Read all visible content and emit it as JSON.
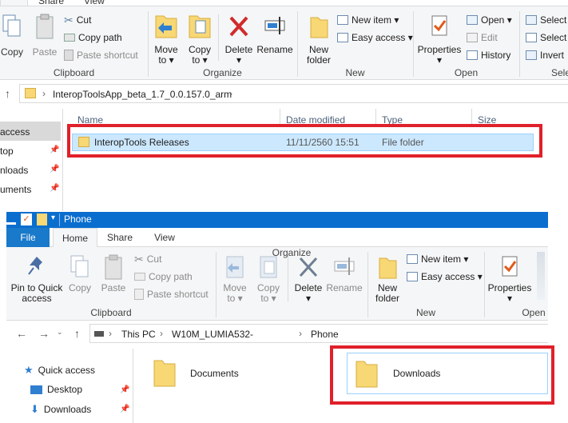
{
  "top_window": {
    "tabs": [
      "",
      "Share",
      "View"
    ],
    "clipboard": {
      "copy": "Copy",
      "paste": "Paste",
      "cut": "Cut",
      "copy_path": "Copy path",
      "paste_shortcut": "Paste shortcut",
      "label": "Clipboard"
    },
    "organize": {
      "move_to": "Move",
      "move_to_2": "to ▾",
      "copy_to": "Copy",
      "copy_to_2": "to ▾",
      "delete": "Delete",
      "delete_2": "▾",
      "rename": "Rename",
      "label": "Organize"
    },
    "new": {
      "new_folder": "New",
      "new_folder_2": "folder",
      "new_item": "New item ▾",
      "easy_access": "Easy access ▾",
      "label": "New"
    },
    "open": {
      "properties": "Properties",
      "properties_2": "▾",
      "open": "Open ▾",
      "edit": "Edit",
      "history": "History",
      "label": "Open"
    },
    "select": {
      "select_all": "Select",
      "select_none": "Select",
      "invert": "Invert",
      "label": "Sele"
    },
    "address": {
      "path": "InteropToolsApp_beta_1.7_0.0.157.0_arm"
    },
    "columns": {
      "name": "Name",
      "date": "Date modified",
      "type": "Type",
      "size": "Size"
    },
    "row": {
      "name": "InteropTools Releases",
      "date": "11/11/2560 15:51",
      "type": "File folder"
    },
    "nav": [
      "access",
      "top",
      "nloads",
      "uments"
    ]
  },
  "bottom_window": {
    "title": "Phone",
    "tabs": {
      "file": "File",
      "home": "Home",
      "share": "Share",
      "view": "View"
    },
    "clipboard": {
      "pin": "Pin to Quick",
      "pin_2": "access",
      "copy": "Copy",
      "paste": "Paste",
      "cut": "Cut",
      "copy_path": "Copy path",
      "paste_shortcut": "Paste shortcut",
      "label": "Clipboard"
    },
    "organize": {
      "move_to": "Move",
      "move_to_2": "to ▾",
      "copy_to": "Copy",
      "copy_to_2": "to ▾",
      "delete": "Delete",
      "delete_2": "▾",
      "rename": "Rename",
      "label": "Organize"
    },
    "new": {
      "new_folder": "New",
      "new_folder_2": "folder",
      "new_item": "New item ▾",
      "easy_access": "Easy access ▾",
      "label": "New"
    },
    "open": {
      "properties": "Properties",
      "properties_2": "▾",
      "label": "Open"
    },
    "address": {
      "this_pc": "This PC",
      "device": "W10M_LUMIA532-",
      "phone": "Phone"
    },
    "nav": {
      "quick_access": "Quick access",
      "desktop": "Desktop",
      "downloads": "Downloads"
    },
    "items": {
      "documents": "Documents",
      "downloads": "Downloads"
    }
  },
  "colors": {
    "highlight": "#e0202a",
    "selection": "#cce8ff",
    "titlebar": "#0a6ecf",
    "folder": "#f8d775"
  }
}
